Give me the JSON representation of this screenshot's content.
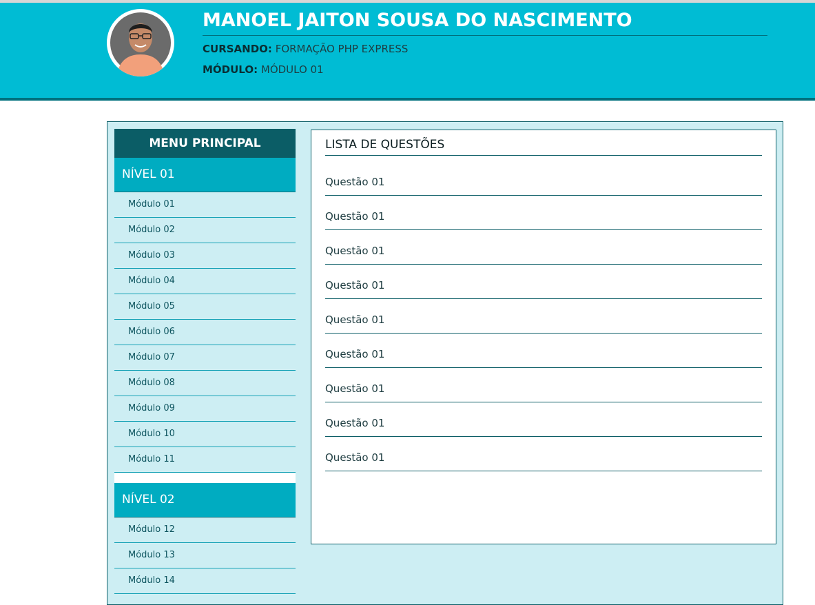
{
  "header": {
    "name": "MANOEL JAITON SOUSA DO NASCIMENTO",
    "course_label": "CURSANDO:",
    "course_value": "FORMAÇÃO PHP EXPRESS",
    "module_label": "MÓDULO:",
    "module_value": "MÓDULO 01"
  },
  "sidebar": {
    "title": "MENU PRINCIPAL",
    "levels": [
      {
        "label": "NÍVEL 01",
        "modules": [
          "Módulo 01",
          "Módulo 02",
          "Módulo 03",
          "Módulo 04",
          "Módulo 05",
          "Módulo 06",
          "Módulo 07",
          "Módulo 08",
          "Módulo 09",
          "Módulo 10",
          "Módulo 11"
        ]
      },
      {
        "label": "NÍVEL 02",
        "modules": [
          "Módulo 12",
          "Módulo 13",
          "Módulo 14"
        ]
      }
    ]
  },
  "main": {
    "title": "LISTA DE QUESTÕES",
    "questions": [
      "Questão 01",
      "Questão 01",
      "Questão 01",
      "Questão 01",
      "Questão 01",
      "Questão 01",
      "Questão 01",
      "Questão 01",
      "Questão 01"
    ]
  },
  "colors": {
    "header_bg": "#00bcd4",
    "dark_teal": "#0b5d66",
    "level_bg": "#00acc1",
    "content_bg": "#cdeef3"
  }
}
